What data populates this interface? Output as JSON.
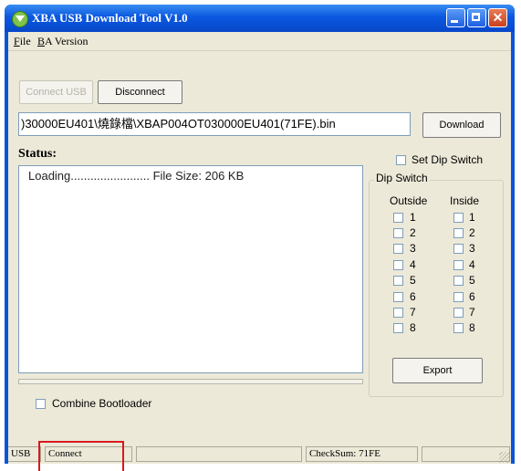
{
  "window": {
    "title": "XBA USB Download Tool V1.0"
  },
  "menu": [
    "File",
    "BA Version"
  ],
  "buttons": {
    "connect_usb": "Connect USB",
    "disconnect": "Disconnect",
    "download": "Download",
    "export": "Export"
  },
  "file_path": ")30000EU401\\燒錄檔\\XBAP004OT030000EU401(71FE).bin",
  "status": {
    "label": "Status:",
    "text": "Loading........................ File Size: 206 KB"
  },
  "set_dip_switch": {
    "label": "Set Dip Switch",
    "checked": false
  },
  "dip_switch": {
    "title": "Dip Switch",
    "outside_label": "Outside",
    "inside_label": "Inside",
    "outside": [
      "1",
      "2",
      "3",
      "4",
      "5",
      "6",
      "7",
      "8"
    ],
    "inside": [
      "1",
      "2",
      "3",
      "4",
      "5",
      "6",
      "7",
      "8"
    ]
  },
  "combine_bootloader": {
    "label": "Combine Bootloader",
    "checked": false
  },
  "statusbar": {
    "usb_label": "USB",
    "usb_state": "Connect",
    "checksum": "CheckSum: 71FE"
  },
  "colors": {
    "title_bar": "#0a58e0",
    "dialog_bg": "#ece9d8",
    "highlight": "#d71920"
  }
}
